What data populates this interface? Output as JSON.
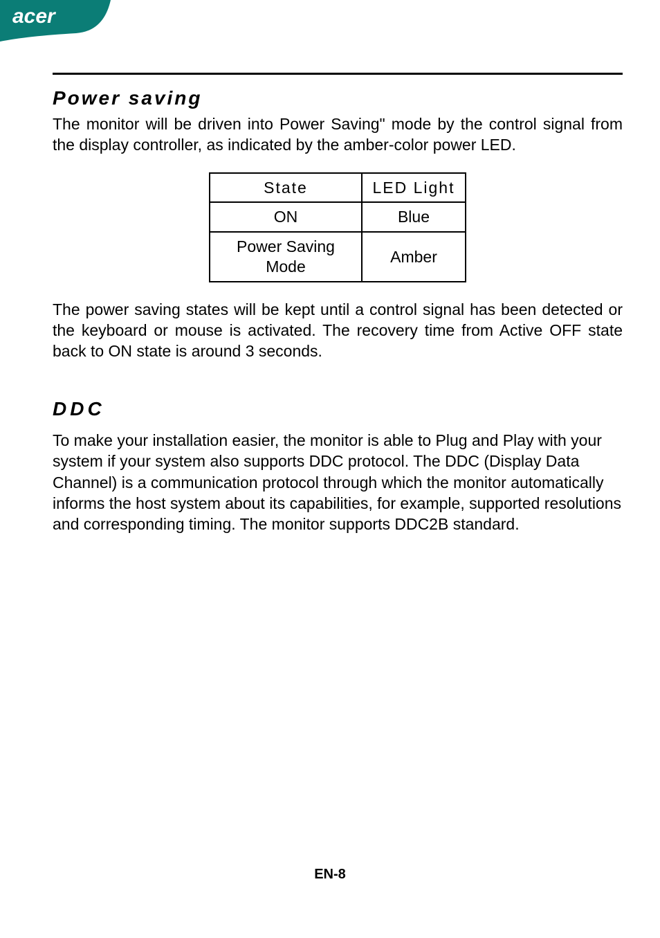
{
  "brand": {
    "name": "acer"
  },
  "section_power": {
    "heading": "Power saving",
    "intro": "The monitor will be driven into Power Saving\" mode by the control signal from the display controller, as indicated by the amber-color power LED.",
    "table": {
      "head_state": "State",
      "head_led": "LED Light",
      "row1_state": "ON",
      "row1_led": "Blue",
      "row2_state": "Power Saving Mode",
      "row2_led": "Amber"
    },
    "outro": "The power saving states will be kept until a control signal has been detected or the keyboard or mouse is activated. The recovery time from Active OFF state back to ON state is around 3 seconds."
  },
  "section_ddc": {
    "heading": "DDC",
    "body": "To make your installation easier, the monitor is able to Plug and Play with your system if your system also supports DDC protocol. The DDC (Display Data Channel) is a communication protocol through which the monitor automatically informs the host system  about its capabilities, for example, supported resolutions and corresponding timing. The monitor supports DDC2B standard."
  },
  "footer": {
    "page": "EN-8"
  }
}
